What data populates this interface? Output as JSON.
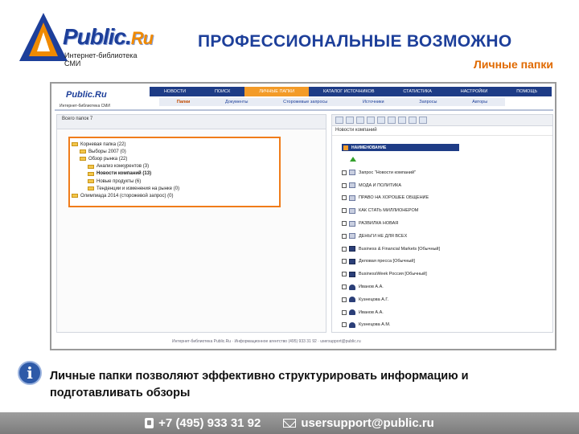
{
  "logo": {
    "brand": "Public.",
    "brand_suffix": "Ru",
    "tagline": "Интернет-библиотека СМИ"
  },
  "slide": {
    "title": "ПРОФЕССИОНАЛЬНЫЕ ВОЗМОЖНО",
    "subtitle": "Личные папки"
  },
  "app": {
    "logo_title": "Public.Ru",
    "logo_tagline": "Интернет-библиотека СМИ",
    "top_nav": [
      "НОВОСТИ",
      "ПОИСК",
      "ЛИЧНЫЕ ПАПКИ",
      "КАТАЛОГ ИСТОЧНИКОВ",
      "СТАТИСТИКА",
      "НАСТРОЙКИ",
      "ПОМОЩЬ"
    ],
    "sub_nav": [
      "Папки",
      "Документы",
      "Сторожевые запросы",
      "Источники",
      "Запросы",
      "Авторы"
    ],
    "left": {
      "count_label": "Всего папок 7",
      "tree": [
        {
          "label": "Корневая папка (22)",
          "level": 0,
          "bold": false
        },
        {
          "label": "Выборы 2007 (0)",
          "level": 1,
          "bold": false
        },
        {
          "label": "Обзор рынка (22)",
          "level": 1,
          "bold": false
        },
        {
          "label": "Анализ конкурентов (3)",
          "level": 2,
          "bold": false
        },
        {
          "label": "Новости компаний (13)",
          "level": 2,
          "bold": true
        },
        {
          "label": "Новые продукты (6)",
          "level": 2,
          "bold": false
        },
        {
          "label": "Тенденции и изменения на рынке (0)",
          "level": 2,
          "bold": false
        },
        {
          "label": "Олимпиада 2014 (сторожевой запрос) (0)",
          "level": 0,
          "bold": false
        }
      ]
    },
    "right": {
      "title": "Новости компаний",
      "column_header": "НАИМЕНОВАНИЕ",
      "rows": [
        {
          "label": "Запрос \"Новости компаний\"",
          "icon": "doc"
        },
        {
          "label": "МОДА И ПОЛИТИКА",
          "icon": "doc"
        },
        {
          "label": "ПРАВО НА ХОРОШЕЕ ОБЩЕНИЕ",
          "icon": "doc"
        },
        {
          "label": "КАК СТАТЬ МИЛЛИОНЕРОМ",
          "icon": "doc"
        },
        {
          "label": "РАЗВИЛКА НОВАЯ",
          "icon": "doc"
        },
        {
          "label": "ДЕНЬГИ НЕ ДЛЯ ВСЕХ",
          "icon": "doc"
        },
        {
          "label": "Business & Financial Markets [Обычный]",
          "icon": "dark"
        },
        {
          "label": "Деловая пресса [Обычный]",
          "icon": "dark"
        },
        {
          "label": "BusinessWeek Россия [Обычный]",
          "icon": "dark"
        },
        {
          "label": "Иванов А.А.",
          "icon": "user"
        },
        {
          "label": "Кузнецова А.Г.",
          "icon": "user"
        },
        {
          "label": "Иванов А.А.",
          "icon": "user"
        },
        {
          "label": "Кузнецова А.М.",
          "icon": "user"
        }
      ]
    },
    "footer_line": "Интернет-библиотека Public.Ru · Информационное агентство (495) 933 31 92 · usersupport@public.ru"
  },
  "info": {
    "text": "Личные папки позволяют эффективно структурировать информацию и подготавливать обзоры"
  },
  "footer": {
    "phone": "+7 (495) 933 31 92",
    "email": "usersupport@public.ru"
  },
  "colors": {
    "brand_blue": "#1d3f9a",
    "accent_orange": "#e06a00",
    "nav_blue": "#1e3c86"
  }
}
